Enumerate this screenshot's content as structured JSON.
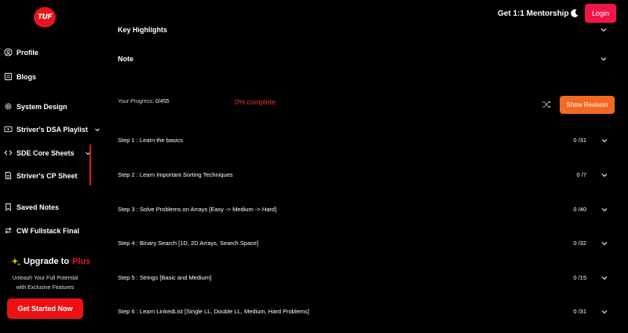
{
  "header": {
    "logo_text": "TUF",
    "mentorship": "Get 1:1 Mentorship",
    "login": "Login"
  },
  "sidebar": {
    "items": [
      {
        "label": "Profile"
      },
      {
        "label": "Blogs"
      },
      {
        "label": "System Design"
      },
      {
        "label": "Striver's DSA Playlist"
      },
      {
        "label": "SDE Core Sheets"
      },
      {
        "label": "Striver's CP Sheet"
      },
      {
        "label": "Saved Notes"
      },
      {
        "label": "CW Fullstack Final"
      }
    ],
    "upgrade_title": "Upgrade to",
    "upgrade_plus": "Plus",
    "upgrade_line1": "Unleash Your Full Potential",
    "upgrade_line2": "with Exclusive Features",
    "cta": "Get Started Now"
  },
  "main": {
    "key_highlights": "Key Highlights",
    "note": "Note",
    "progress_label": "Your Progress:",
    "progress_value": "0/455",
    "percent": "0% complete",
    "revision_button": "Show Revision",
    "steps": [
      {
        "title": "Step 1 : Learn the basics",
        "count": "0 /31"
      },
      {
        "title": "Step 2 : Learn Important Sorting Techniques",
        "count": "0 /7"
      },
      {
        "title": "Step 3 : Solve Problems on Arrays [Easy -> Medium -> Hard]",
        "count": "0 /40"
      },
      {
        "title": "Step 4 : Binary Search [1D, 2D Arrays, Search Space]",
        "count": "0 /32"
      },
      {
        "title": "Step 5 : Strings [Basic and Medium]",
        "count": "0 /15"
      },
      {
        "title": "Step 6 : Learn LinkedList [Single LL, Double LL, Medium, Hard Problems]",
        "count": "0 /31"
      }
    ]
  },
  "colors": {
    "brand_red": "#e8141e",
    "login_pink": "#f0164a",
    "revision_orange": "#f26a22",
    "background": "#000000"
  }
}
